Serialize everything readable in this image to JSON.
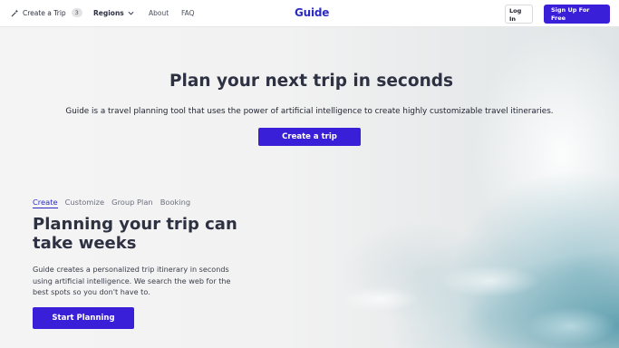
{
  "nav": {
    "create_trip_label": "Create a Trip",
    "create_trip_count": "3",
    "regions_label": "Regions",
    "about_label": "About",
    "faq_label": "FAQ",
    "logo_text": "Guide",
    "login_label": "Log In",
    "signup_label": "Sign Up For Free"
  },
  "hero": {
    "title_regular": "Plan your next trip ",
    "title_bold": "in seconds",
    "subtitle": "Guide is a travel planning tool that uses the power of artificial intelligence to create highly customizable travel itineraries.",
    "cta_label": "Create a trip"
  },
  "features": {
    "tabs": [
      {
        "label": "Create",
        "active": true
      },
      {
        "label": "Customize",
        "active": false
      },
      {
        "label": "Group Plan",
        "active": false
      },
      {
        "label": "Booking",
        "active": false
      }
    ],
    "title": "Planning your trip can take weeks",
    "body": "Guide creates a personalized trip itinerary in seconds using artificial intelligence. We search the web for the best spots so you don't have to.",
    "cta_label": "Start Planning"
  },
  "colors": {
    "accent": "#3a1fd9",
    "logo": "#2b2bc2",
    "text": "#2d3142"
  },
  "icons": {
    "create_trip": "magic-wand-icon",
    "regions": "chevron-down-icon"
  }
}
